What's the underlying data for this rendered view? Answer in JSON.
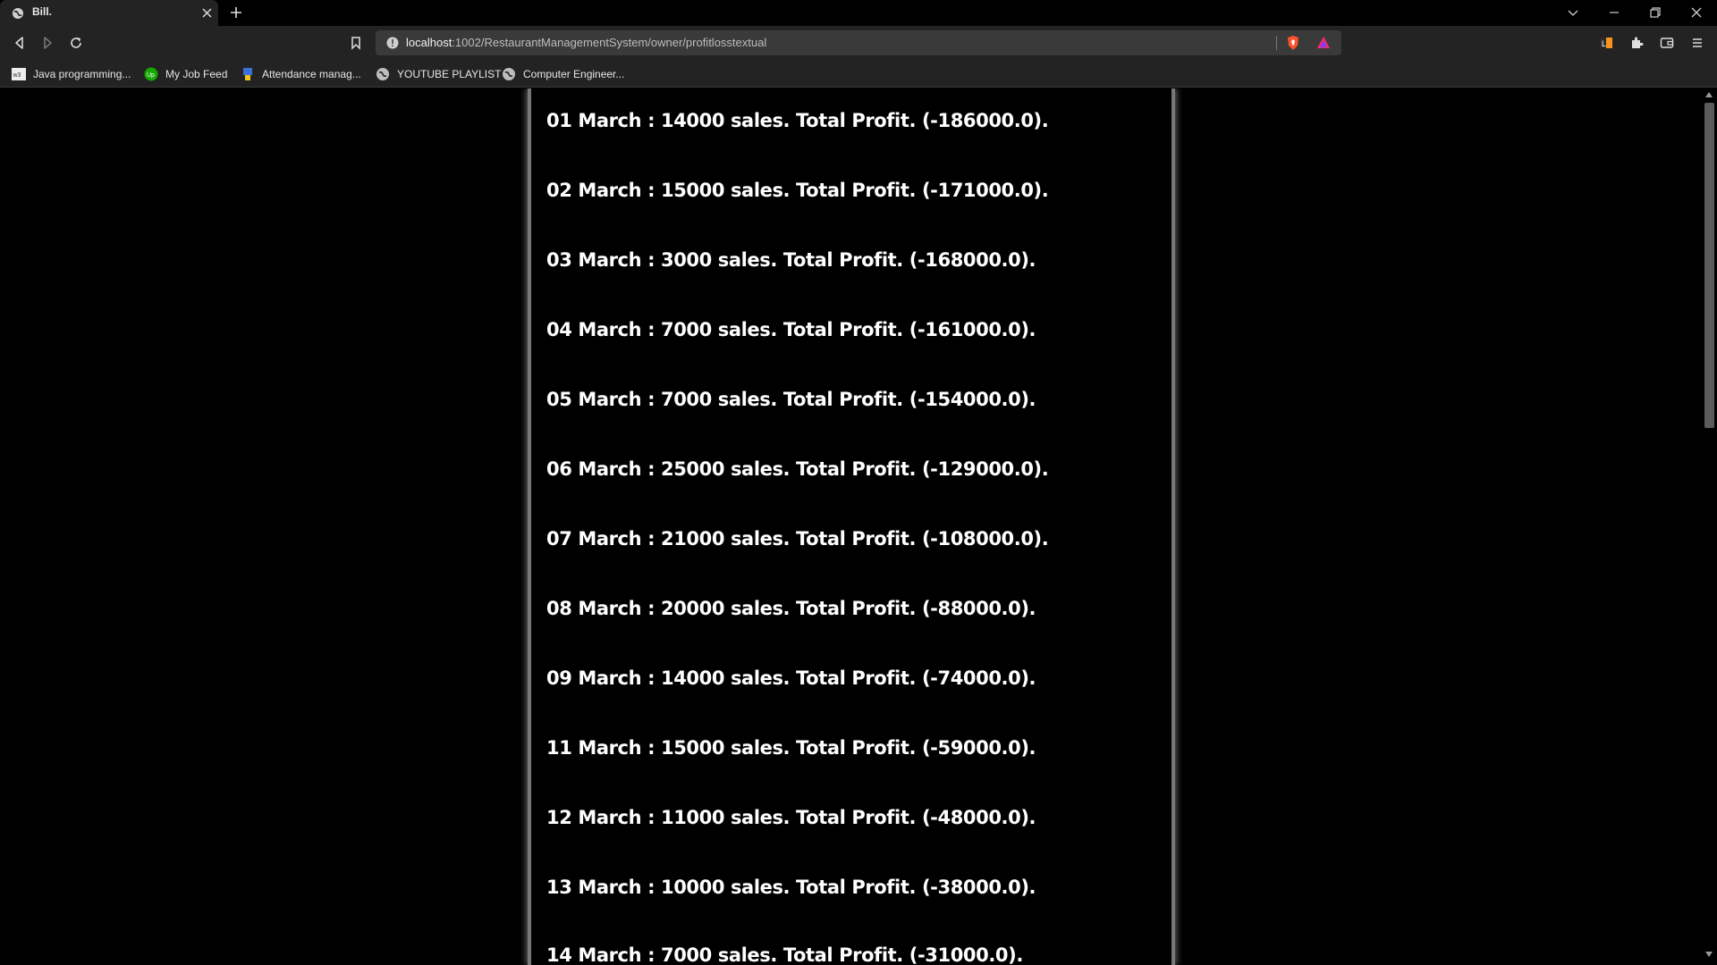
{
  "browser": {
    "tab_title": "Bill.",
    "url_host": "localhost",
    "url_path": ":1002/RestaurantManagementSystem/owner/profitlosstextual"
  },
  "bookmarks": [
    {
      "label": "Java programming...",
      "icon": "w3-icon"
    },
    {
      "label": "My Job Feed",
      "icon": "upwork-icon"
    },
    {
      "label": "Attendance manag...",
      "icon": "bookmark-site-icon"
    },
    {
      "label": "YOUTUBE PLAYLIST",
      "icon": "globe-icon"
    },
    {
      "label": "Computer Engineer...",
      "icon": "globe-icon"
    }
  ],
  "entries": [
    "01 March : 14000 sales. Total Profit. (-186000.0).",
    "02 March : 15000 sales. Total Profit. (-171000.0).",
    "03 March : 3000 sales. Total Profit. (-168000.0).",
    "04 March : 7000 sales. Total Profit. (-161000.0).",
    "05 March : 7000 sales. Total Profit. (-154000.0).",
    "06 March : 25000 sales. Total Profit. (-129000.0).",
    "07 March : 21000 sales. Total Profit. (-108000.0).",
    "08 March : 20000 sales. Total Profit. (-88000.0).",
    "09 March : 14000 sales. Total Profit. (-74000.0).",
    "11 March : 15000 sales. Total Profit. (-59000.0).",
    "12 March : 11000 sales. Total Profit. (-48000.0).",
    "13 March : 10000 sales. Total Profit. (-38000.0).",
    "14 March : 7000 sales. Total Profit. (-31000.0)."
  ],
  "colors": {
    "page_bg": "#000000",
    "text": "#ffffff",
    "chrome": "#232323",
    "panel_border": "#777777"
  }
}
